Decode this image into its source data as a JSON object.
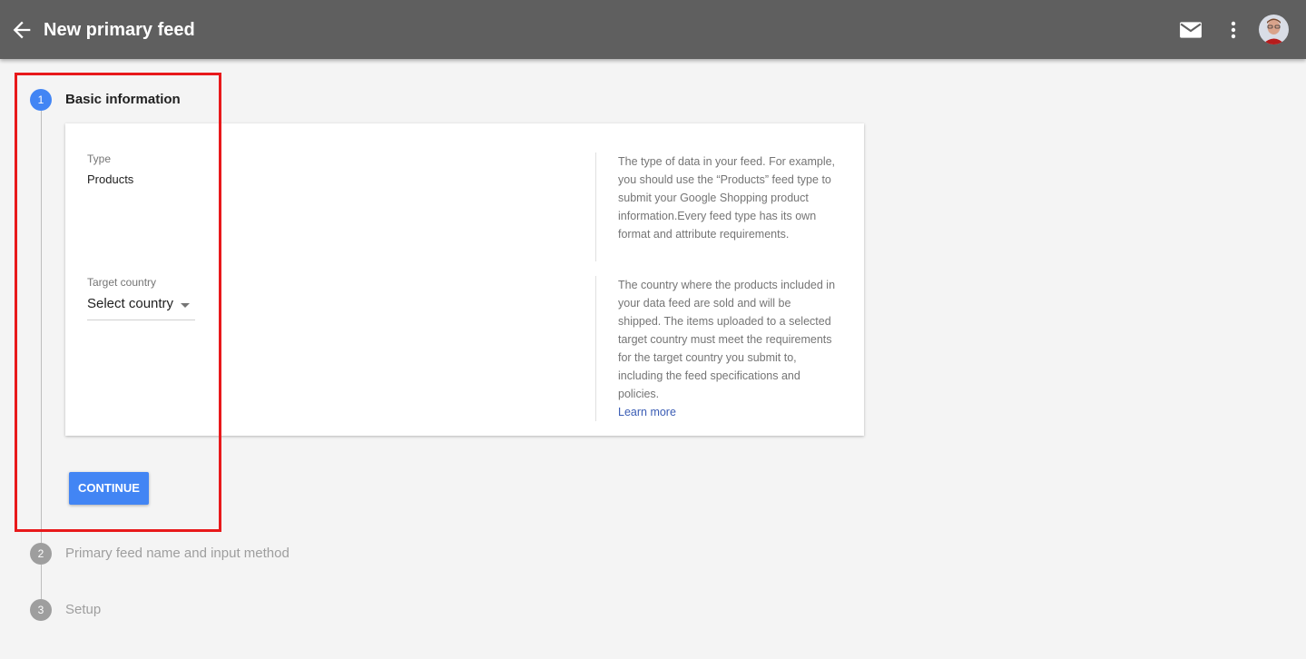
{
  "header": {
    "title": "New primary feed",
    "back_icon": "arrow-left-icon",
    "mail_icon": "mail-icon",
    "more_icon": "more-vert-icon",
    "bar_color": "#5f5f5f"
  },
  "steps": [
    {
      "number": "1",
      "label": "Basic information",
      "state": "active"
    },
    {
      "number": "2",
      "label": "Primary feed name and input method",
      "state": "inactive"
    },
    {
      "number": "3",
      "label": "Setup",
      "state": "inactive"
    }
  ],
  "form": {
    "type": {
      "label": "Type",
      "value": "Products",
      "help": "The type of data in your feed. For example, you should use the “Products” feed type to submit your Google Shopping product information.Every feed type has its own format and attribute requirements."
    },
    "target_country": {
      "label": "Target country",
      "value": "Select country",
      "help": "The country where the products included in your data feed are sold and will be shipped. The items uploaded to a selected target country must meet the requirements for the target country you submit to, including the feed specifications and policies.",
      "learn_more": "Learn more"
    }
  },
  "actions": {
    "continue_label": "CONTINUE"
  },
  "colors": {
    "accent": "#4285f4",
    "highlight": "#e8191b",
    "link": "#3b5db5"
  }
}
